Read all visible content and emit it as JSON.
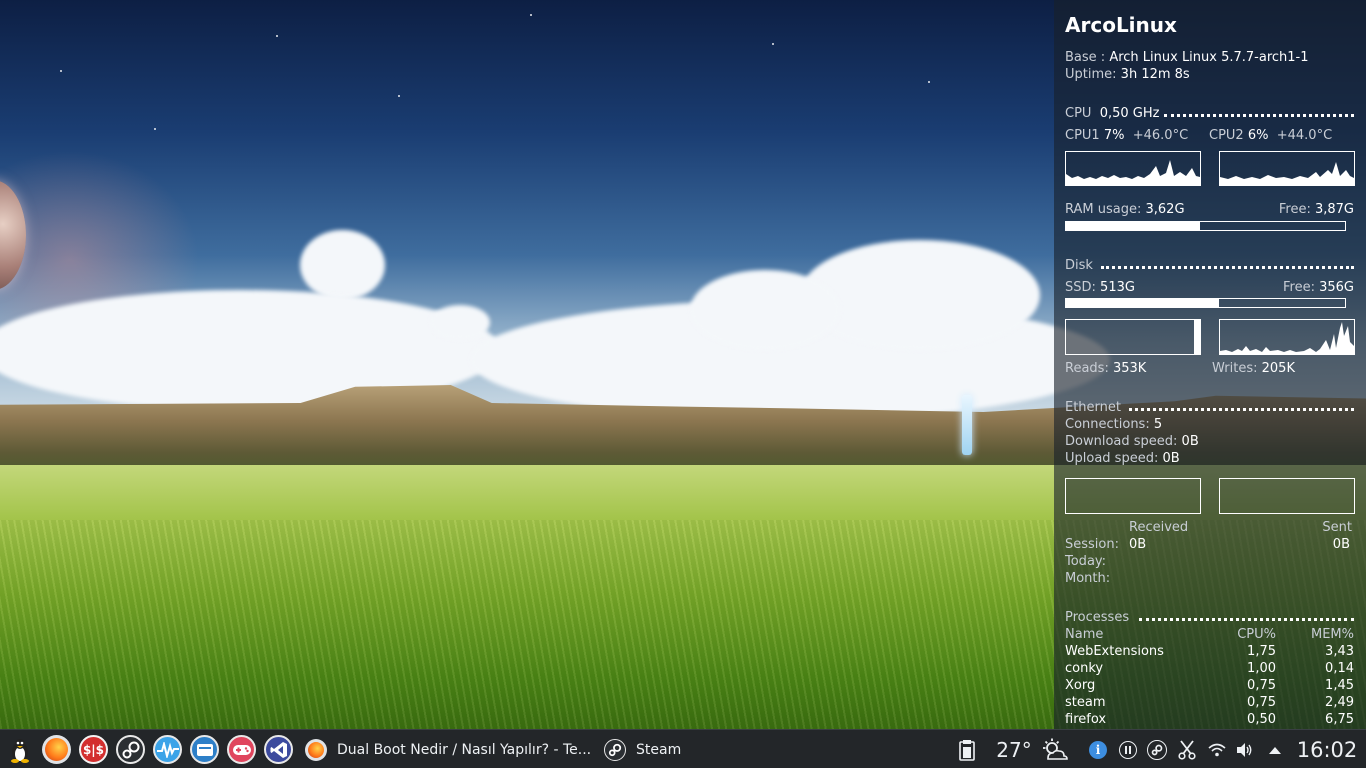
{
  "conky": {
    "title": "ArcoLinux",
    "base_label": "Base :",
    "base_value": "Arch Linux Linux 5.7.7-arch1-1",
    "uptime_label": "Uptime:",
    "uptime_value": "3h 12m 8s",
    "cpu": {
      "label": "CPU",
      "freq": "0,50 GHz",
      "cpu1_label": "CPU1",
      "cpu1_usage": "7%",
      "cpu1_temp": "+46.0°C",
      "cpu2_label": "CPU2",
      "cpu2_usage": "6%",
      "cpu2_temp": "+44.0°C"
    },
    "ram": {
      "label": "RAM usage:",
      "used": "3,62G",
      "free_label": "Free:",
      "free": "3,87G",
      "usage_fraction": 0.48
    },
    "disk": {
      "label": "Disk",
      "ssd_label": "SSD:",
      "ssd_size": "513G",
      "free_label": "Free:",
      "free": "356G",
      "usage_fraction": 0.55,
      "reads_label": "Reads:",
      "reads": "353K",
      "writes_label": "Writes:",
      "writes": "205K"
    },
    "ethernet": {
      "label": "Ethernet",
      "connections_label": "Connections:",
      "connections": "5",
      "download_label": "Download speed:",
      "download": "0B",
      "upload_label": "Upload speed:",
      "upload": "0B",
      "received_label": "Received",
      "sent_label": "Sent",
      "session_label": "Session:",
      "session_received": "0B",
      "session_sent": "0B",
      "today_label": "Today:",
      "month_label": "Month:"
    },
    "processes": {
      "label": "Processes",
      "headers": {
        "name": "Name",
        "cpu": "CPU%",
        "mem": "MEM%"
      },
      "rows": [
        {
          "name": "WebExtensions",
          "cpu": "1,75",
          "mem": "3,43"
        },
        {
          "name": "conky",
          "cpu": "1,00",
          "mem": "0,14"
        },
        {
          "name": "Xorg",
          "cpu": "0,75",
          "mem": "1,45"
        },
        {
          "name": "steam",
          "cpu": "0,75",
          "mem": "2,49"
        },
        {
          "name": "firefox",
          "cpu": "0,50",
          "mem": "6,75"
        }
      ]
    }
  },
  "taskbar": {
    "launchers": [
      {
        "icon": "tux-icon"
      },
      {
        "icon": "firefox-icon"
      },
      {
        "icon": "money-manager-icon"
      },
      {
        "icon": "steam-icon"
      },
      {
        "icon": "system-monitor-icon"
      },
      {
        "icon": "file-manager-icon"
      },
      {
        "icon": "game-controller-icon"
      },
      {
        "icon": "vscode-icon"
      }
    ],
    "tasks": [
      {
        "icon": "firefox-icon",
        "label": "Dual Boot Nedir / Nasıl Yapılır? - Te..."
      },
      {
        "icon": "steam-icon",
        "label": "Steam"
      }
    ],
    "weather_temp": "27°",
    "clock": "16:02",
    "tray_icons": [
      "clipboard-icon",
      "weather-icon",
      "info-icon",
      "pause-icon",
      "steam-icon",
      "scissors-icon",
      "wifi-icon",
      "volume-icon",
      "arrow-up-icon"
    ]
  },
  "colors": {
    "panel_bg": "#19202a",
    "taskbar_bg": "#232629",
    "info_blue": "#3d8ee0",
    "firefox_orange": "#e66000",
    "money_red": "#d32f2f",
    "monitor_blue": "#3ba3e8",
    "files_blue": "#2d7fc8",
    "game_red": "#e0455d",
    "vscode_blue": "#3c4a9e"
  }
}
